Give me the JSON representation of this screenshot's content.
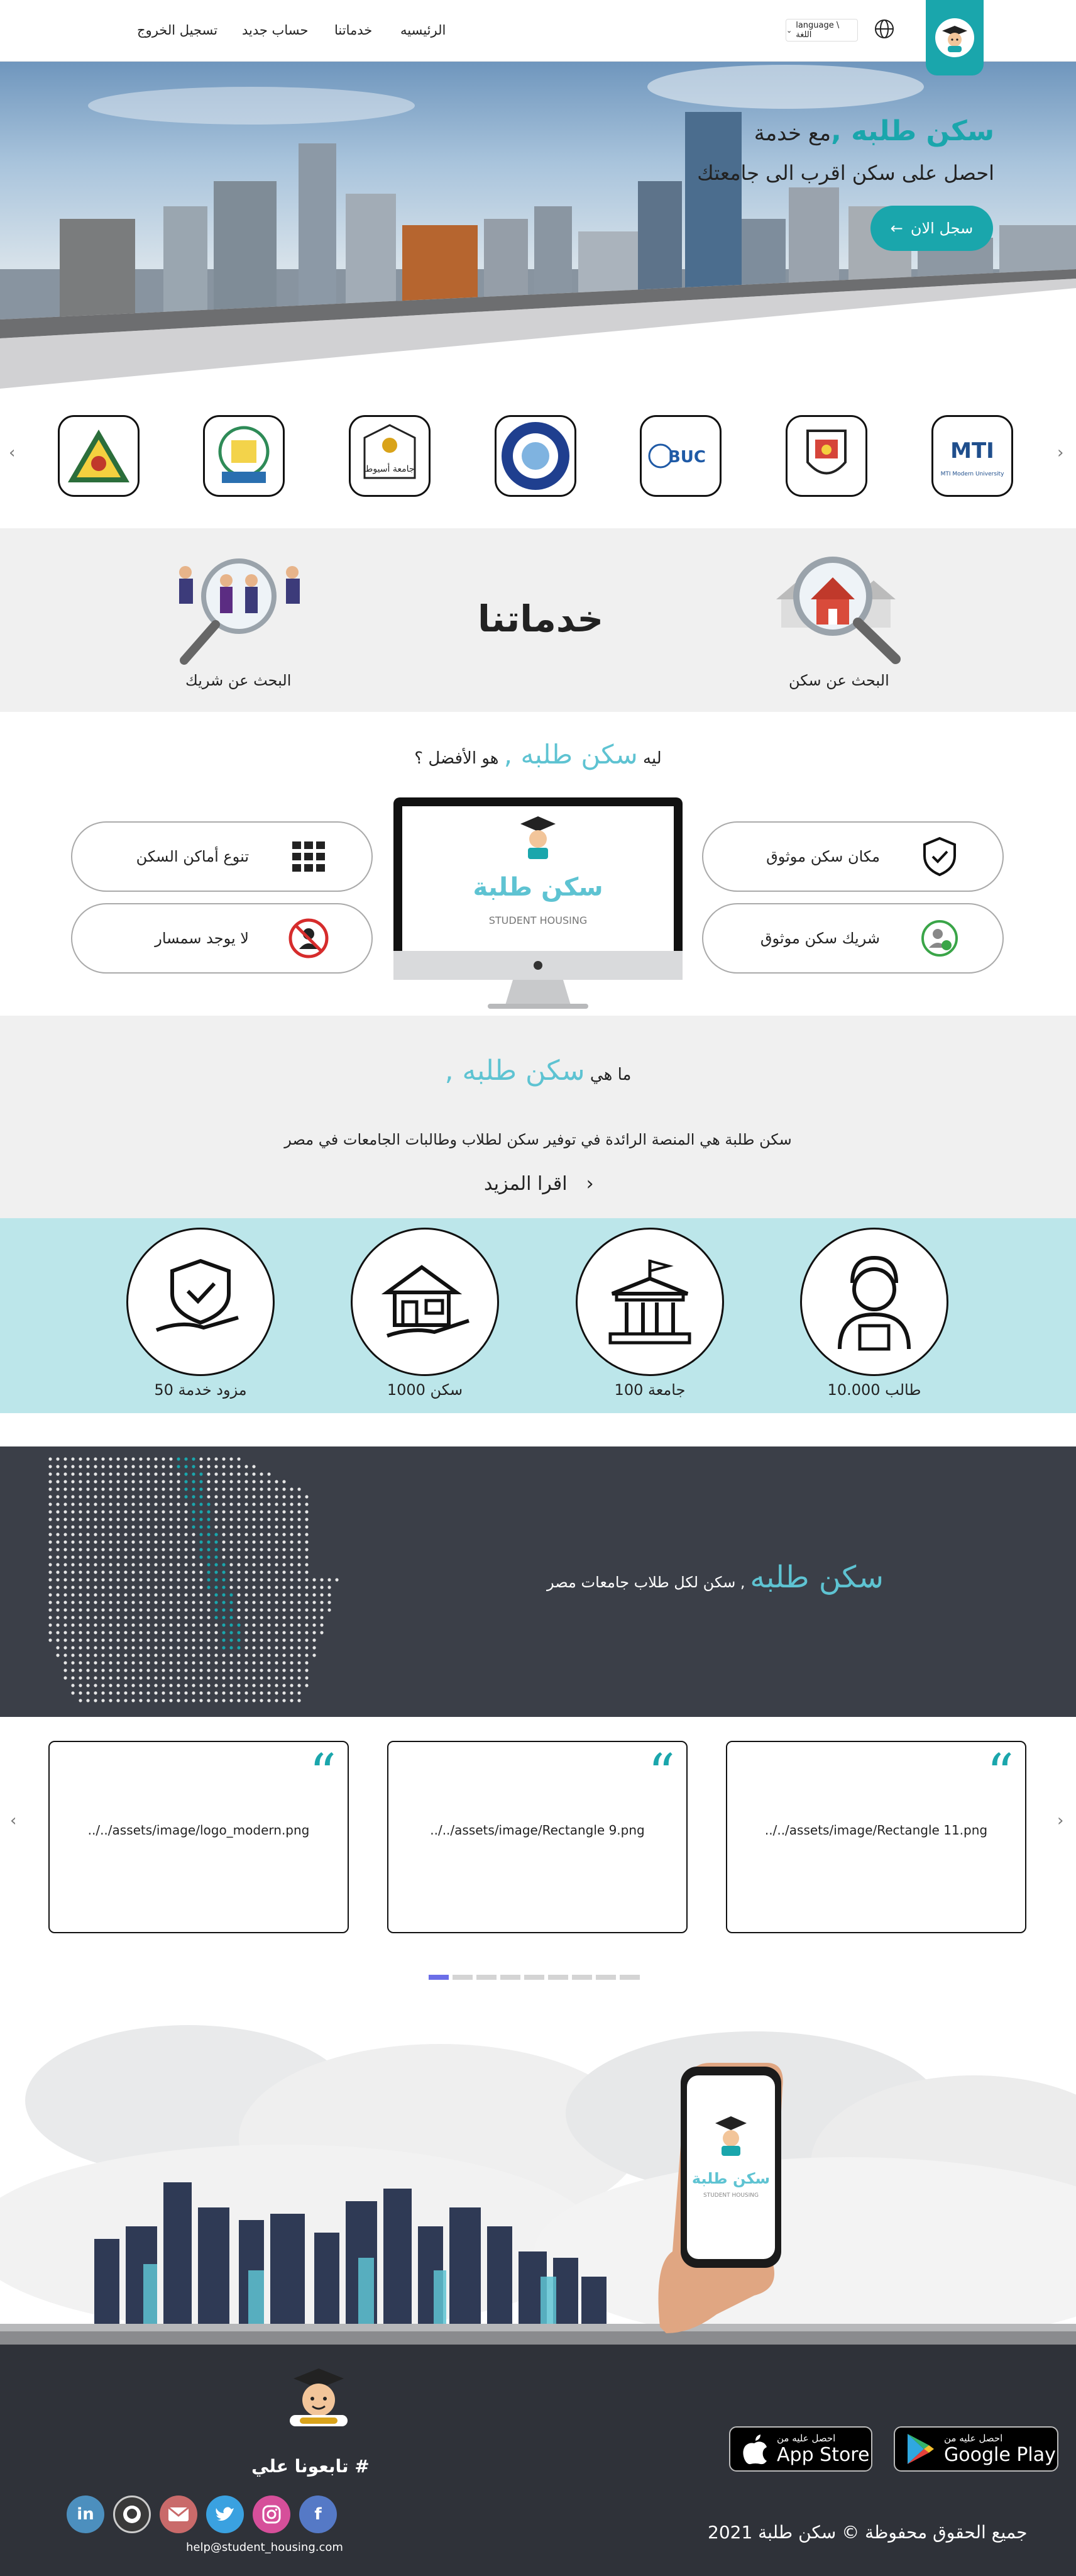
{
  "nav": {
    "home": "الرئيسيه",
    "services": "خدماتنا",
    "register": "حساب جديد",
    "logout": "تسجيل الخروج",
    "language": "language \\ اللغة"
  },
  "hero": {
    "line1_prefix": "مع خدمة",
    "brand": "سكن طلبه ,",
    "line2": "احصل على سكن اقرب الى جامعتك",
    "cta": "سجل الان"
  },
  "universities": [
    "MTI Modern University",
    "",
    "BUC",
    "",
    "جامعة أسيوط",
    "",
    ""
  ],
  "services": {
    "title": "خدماتنا",
    "search_housing": "البحث عن سكن",
    "search_partner": "البحث عن شريك"
  },
  "why": {
    "prefix": "ليه",
    "brand": "سكن طلبه ,",
    "suffix": "هو الأفضل ؟",
    "features": [
      "مكان سكن موثوق",
      "شريك سكن موثوق",
      "تنوع أماكن السكن",
      "لا يوجد سمسار"
    ],
    "monitor_brand": "سكن طلبة",
    "monitor_sub": "STUDENT HOUSING"
  },
  "what": {
    "prefix": "ما هي",
    "brand": "سكن طلبه ,",
    "desc": "سكن طلبة هي المنصة الرائدة في توفير سكن لطلاب وطالبات الجامعات في مصر",
    "more": "اقرا المزيد"
  },
  "stats": [
    "10.000 طالب",
    "100 جامعة",
    "1000 سكن",
    "50 مزود خدمة"
  ],
  "mapband": {
    "brand": "سكن طلبه",
    "text": ", سكن لكل طلاب جامعات مصر"
  },
  "testimonials": [
    "../../assets/image/Rectangle 11.png",
    "../../assets/image/Rectangle 9.png",
    "../../assets/image/logo_modern.png"
  ],
  "phone": {
    "brand": "سكن طلبة",
    "sub": "STUDENT HOUSING"
  },
  "footer": {
    "follow": "تابعونا علي #",
    "email": "help@student_housing.com",
    "copyright": "جميع الحقوق محفوظة © سكن طلبة 2021",
    "google_small": "احصل عليه من",
    "google_big": "Google Play",
    "apple_small": "احصل عليه من",
    "apple_big": "App Store"
  },
  "colors": {
    "accent": "#1aa6ac",
    "brand_light": "#5ec3d2",
    "dark": "#2f3239"
  }
}
